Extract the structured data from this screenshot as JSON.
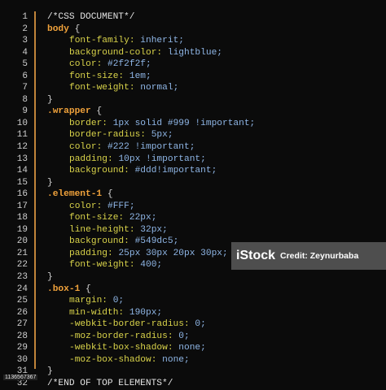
{
  "code_lines": [
    {
      "num": "1",
      "parts": [
        {
          "t": "/*CSS DOCUMENT*/",
          "c": "cmt"
        }
      ]
    },
    {
      "num": "2",
      "parts": [
        {
          "t": "body",
          "c": "sel"
        },
        {
          "t": " {",
          "c": "punct"
        }
      ]
    },
    {
      "num": "3",
      "parts": [
        {
          "t": "font-family: ",
          "c": "prop"
        },
        {
          "t": "inherit;",
          "c": "val"
        }
      ],
      "indent": true
    },
    {
      "num": "4",
      "parts": [
        {
          "t": "background-color: ",
          "c": "prop"
        },
        {
          "t": "lightblue;",
          "c": "val"
        }
      ],
      "indent": true
    },
    {
      "num": "5",
      "parts": [
        {
          "t": "color: ",
          "c": "prop"
        },
        {
          "t": "#2f2f2f;",
          "c": "val"
        }
      ],
      "indent": true
    },
    {
      "num": "6",
      "parts": [
        {
          "t": "font-size: ",
          "c": "prop"
        },
        {
          "t": "1em;",
          "c": "val"
        }
      ],
      "indent": true
    },
    {
      "num": "7",
      "parts": [
        {
          "t": "font-weight: ",
          "c": "prop"
        },
        {
          "t": "normal;",
          "c": "val"
        }
      ],
      "indent": true
    },
    {
      "num": "8",
      "parts": [
        {
          "t": "}",
          "c": "punct"
        }
      ]
    },
    {
      "num": "9",
      "parts": [
        {
          "t": ".wrapper",
          "c": "sel"
        },
        {
          "t": " {",
          "c": "punct"
        }
      ]
    },
    {
      "num": "10",
      "parts": [
        {
          "t": "border: ",
          "c": "prop"
        },
        {
          "t": "1px solid #999 !important;",
          "c": "val"
        }
      ],
      "indent": true
    },
    {
      "num": "11",
      "parts": [
        {
          "t": "border-radius: ",
          "c": "prop"
        },
        {
          "t": "5px;",
          "c": "val"
        }
      ],
      "indent": true
    },
    {
      "num": "12",
      "parts": [
        {
          "t": "color: ",
          "c": "prop"
        },
        {
          "t": "#222 !important;",
          "c": "val"
        }
      ],
      "indent": true
    },
    {
      "num": "13",
      "parts": [
        {
          "t": "padding: ",
          "c": "prop"
        },
        {
          "t": "10px !important;",
          "c": "val"
        }
      ],
      "indent": true
    },
    {
      "num": "14",
      "parts": [
        {
          "t": "background: ",
          "c": "prop"
        },
        {
          "t": "#ddd!important;",
          "c": "val"
        }
      ],
      "indent": true
    },
    {
      "num": "15",
      "parts": [
        {
          "t": "}",
          "c": "punct"
        }
      ]
    },
    {
      "num": "16",
      "parts": [
        {
          "t": ".element-1",
          "c": "sel"
        },
        {
          "t": " {",
          "c": "punct"
        }
      ]
    },
    {
      "num": "17",
      "parts": [
        {
          "t": "color: ",
          "c": "prop"
        },
        {
          "t": "#FFF;",
          "c": "val"
        }
      ],
      "indent": true
    },
    {
      "num": "18",
      "parts": [
        {
          "t": "font-size: ",
          "c": "prop"
        },
        {
          "t": "22px;",
          "c": "val"
        }
      ],
      "indent": true
    },
    {
      "num": "19",
      "parts": [
        {
          "t": "line-height: ",
          "c": "prop"
        },
        {
          "t": "32px;",
          "c": "val"
        }
      ],
      "indent": true
    },
    {
      "num": "20",
      "parts": [
        {
          "t": "background: ",
          "c": "prop"
        },
        {
          "t": "#549dc5;",
          "c": "val"
        }
      ],
      "indent": true
    },
    {
      "num": "21",
      "parts": [
        {
          "t": "padding: ",
          "c": "prop"
        },
        {
          "t": "25px 30px 20px 30px;",
          "c": "val"
        }
      ],
      "indent": true
    },
    {
      "num": "22",
      "parts": [
        {
          "t": "font-weight: ",
          "c": "prop"
        },
        {
          "t": "400;",
          "c": "val"
        }
      ],
      "indent": true
    },
    {
      "num": "23",
      "parts": [
        {
          "t": "}",
          "c": "punct"
        }
      ]
    },
    {
      "num": "24",
      "parts": [
        {
          "t": ".box-1",
          "c": "sel"
        },
        {
          "t": " {",
          "c": "punct"
        }
      ]
    },
    {
      "num": "25",
      "parts": [
        {
          "t": "margin: ",
          "c": "prop"
        },
        {
          "t": "0;",
          "c": "val"
        }
      ],
      "indent": true
    },
    {
      "num": "26",
      "parts": [
        {
          "t": "min-width: ",
          "c": "prop"
        },
        {
          "t": "190px;",
          "c": "val"
        }
      ],
      "indent": true
    },
    {
      "num": "27",
      "parts": [
        {
          "t": "-webkit-border-radius: ",
          "c": "prop"
        },
        {
          "t": "0;",
          "c": "val"
        }
      ],
      "indent": true
    },
    {
      "num": "28",
      "parts": [
        {
          "t": "-moz-border-radius: ",
          "c": "prop"
        },
        {
          "t": "0;",
          "c": "val"
        }
      ],
      "indent": true
    },
    {
      "num": "29",
      "parts": [
        {
          "t": "-webkit-box-shadow: ",
          "c": "prop"
        },
        {
          "t": "none;",
          "c": "val"
        }
      ],
      "indent": true
    },
    {
      "num": "30",
      "parts": [
        {
          "t": "-moz-box-shadow: ",
          "c": "prop"
        },
        {
          "t": "none;",
          "c": "val"
        }
      ],
      "indent": true
    },
    {
      "num": "31",
      "parts": [
        {
          "t": "}",
          "c": "punct"
        }
      ]
    },
    {
      "num": "32",
      "parts": [
        {
          "t": "/*END OF TOP ELEMENTS*/",
          "c": "cmt"
        }
      ]
    }
  ],
  "watermark": {
    "brand": "iStock",
    "credit": "Credit: Zeynurbaba"
  },
  "photo_id": "1136567367",
  "colors": {
    "background": "#0b0b0b",
    "selector": "#f0a23b",
    "property": "#d9d34a",
    "value": "#8fb6e6",
    "gutter_rule": "#c0843a"
  }
}
